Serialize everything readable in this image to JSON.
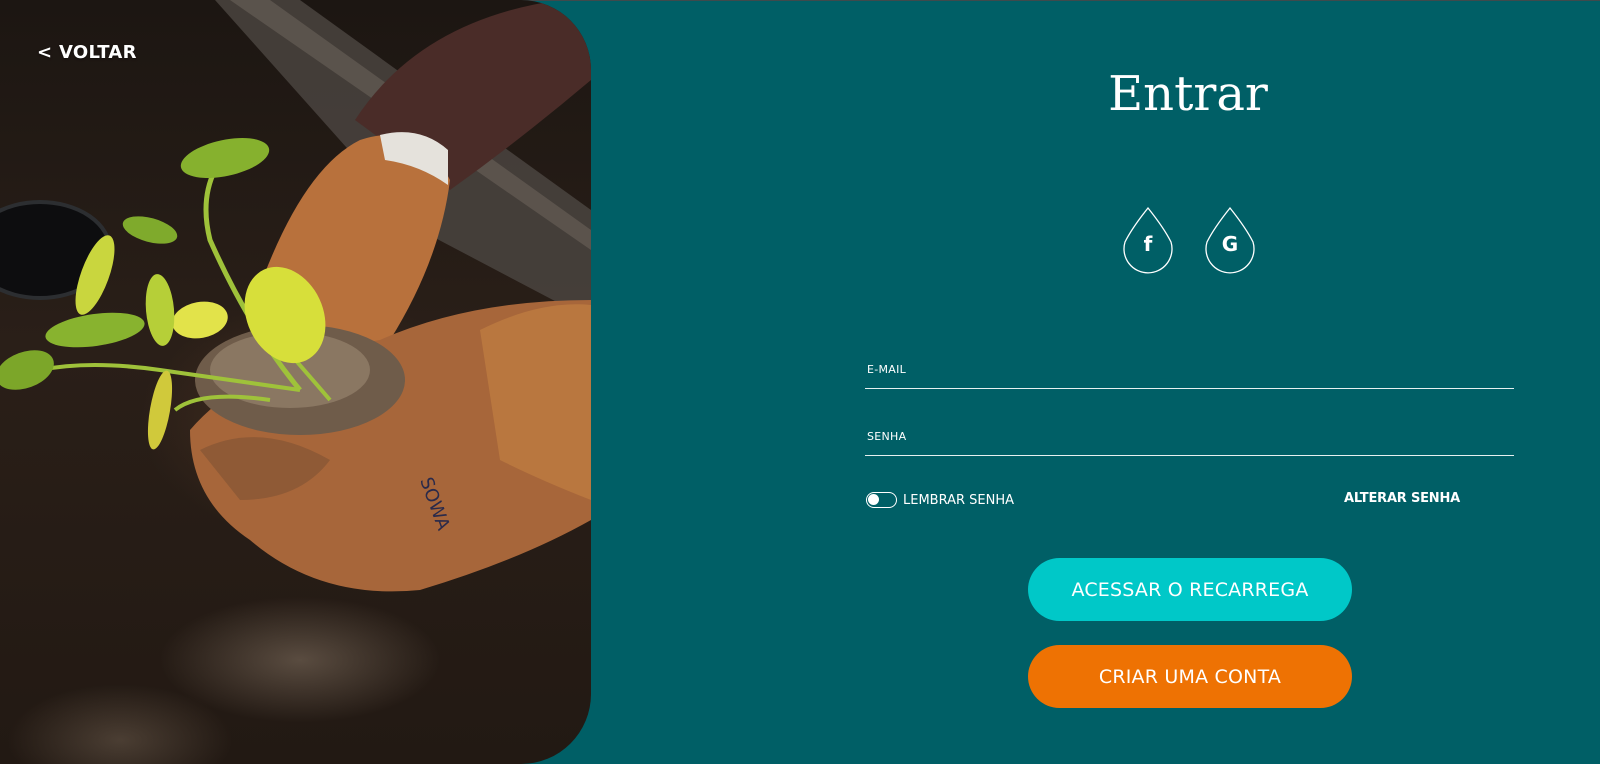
{
  "nav": {
    "back_label": "< VOLTAR"
  },
  "login": {
    "title": "Entrar",
    "social": [
      {
        "icon": "facebook-icon",
        "glyph": "f"
      },
      {
        "icon": "google-icon",
        "glyph": "G"
      }
    ],
    "email_label": "E-MAIL",
    "email_value": "",
    "password_label": "SENHA",
    "password_value": "",
    "remember_label": "LEMBRAR SENHA",
    "remember_checked": false,
    "change_password_label": "ALTERAR SENHA",
    "submit_label": "ACESSAR O RECARREGA",
    "create_account_label": "CRIAR UMA CONTA"
  },
  "colors": {
    "background": "#005f66",
    "primary_button": "#00c8c8",
    "secondary_button": "#ee7203",
    "text": "#ffffff"
  },
  "image": {
    "subject": "gloved-hands-planting-seedling"
  }
}
